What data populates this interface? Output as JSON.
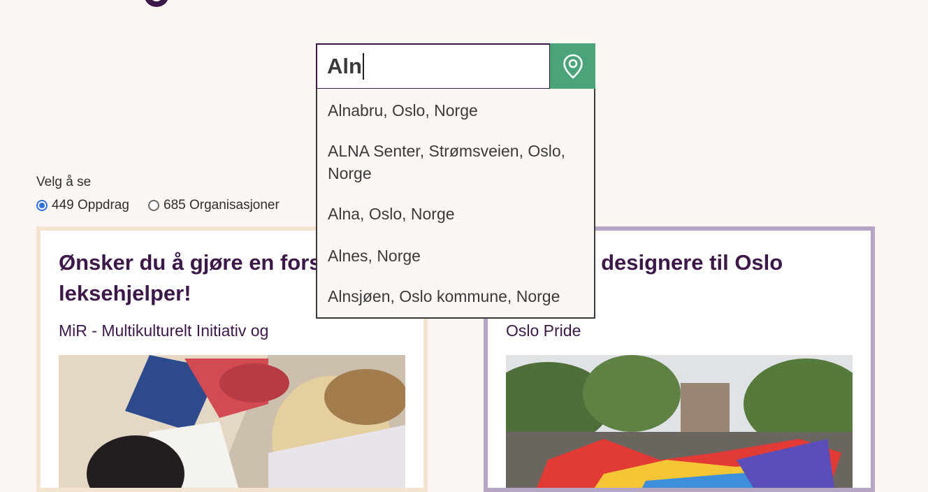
{
  "search": {
    "value": "Aln",
    "suggestions": [
      "Alnabru, Oslo, Norge",
      "ALNA Senter, Strømsveien, Oslo, Norge",
      "Alna, Oslo, Norge",
      "Alnes, Norge",
      "Alnsjøen, Oslo kommune, Norge"
    ]
  },
  "filter": {
    "label": "Velg å se",
    "options": [
      {
        "label": "449 Oppdrag",
        "checked": true
      },
      {
        "label": "685 Organisasjoner",
        "checked": false
      }
    ]
  },
  "cards": [
    {
      "title": "Ønsker du å gjøre en forskjell? Bli leksehjelper!",
      "organization": "MiR - Multikulturelt Initiativ og"
    },
    {
      "title": "Frivillige designere til Oslo",
      "organization": "Oslo Pride"
    }
  ],
  "colors": {
    "background": "#fcf7f3",
    "brand_purple": "#3b1848",
    "location_button": "#4ba37a",
    "card1_border": "#f2e4cf",
    "card2_border": "#b6a6c5",
    "radio_accent": "#2f6fe0"
  },
  "icons": {
    "location_button": "map-pin-icon"
  }
}
